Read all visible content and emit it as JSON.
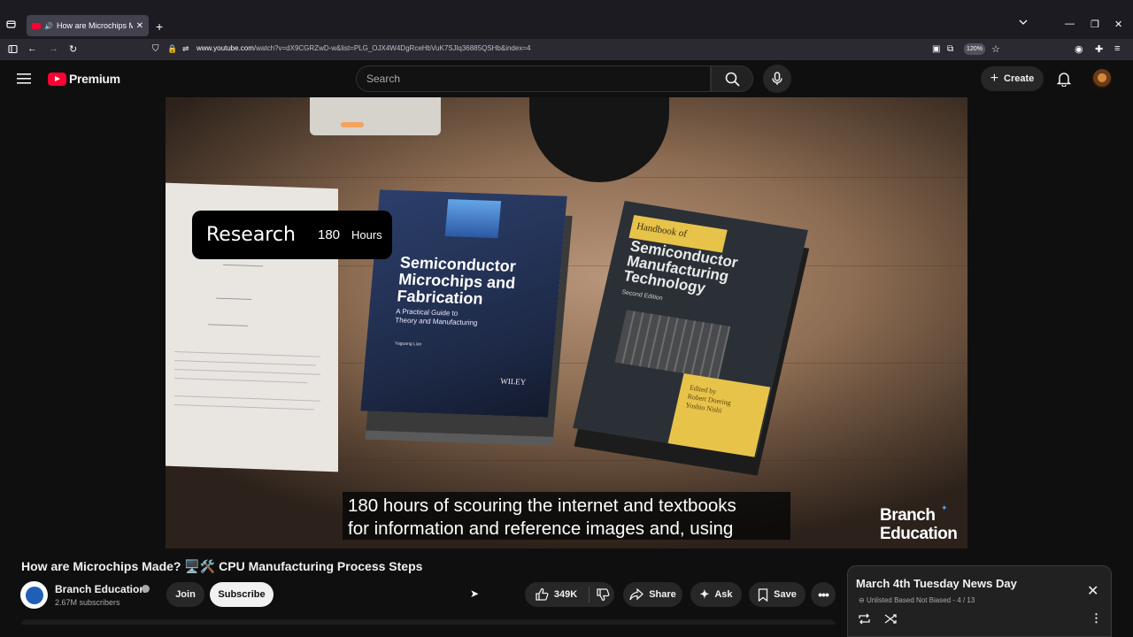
{
  "browser": {
    "tab_title": "How are Microchips Made?",
    "url_prefix": "www.youtube.com",
    "url_rest": "/watch?v=dX9CGRZwD-w&list=PLG_OJX4W4DgRceHbVuK7SJlq36885QSHb&index=4",
    "zoom": "120%"
  },
  "header": {
    "logo_text": "Premium",
    "search_placeholder": "Search",
    "create_label": "Create"
  },
  "video": {
    "overlay_label": "Research",
    "overlay_value": "180",
    "overlay_unit": "Hours",
    "caption_line1": "180 hours of scouring the internet and textbooks",
    "caption_line2": "for information and reference images and, using",
    "watermark_line1": "Branch",
    "watermark_line2": "Education",
    "book_a_title": "Semiconductor Microchips and Fabrication",
    "book_a_subtitle_1": "A Practical Guide to",
    "book_a_subtitle_2": "Theory and Manufacturing",
    "book_a_author": "Yaguang Lian",
    "book_a_publisher": "WILEY",
    "book_b_band": "Handbook of",
    "book_b_title": "Semiconductor Manufacturing Technology",
    "book_b_edition": "Second Edition",
    "book_b_editors_1": "Edited by",
    "book_b_editors_2": "Robert Doering",
    "book_b_editors_3": "Yoshio Nishi"
  },
  "meta": {
    "title": "How are Microchips Made? 🖥️🛠️ CPU Manufacturing Process Steps",
    "channel_name": "Branch Education",
    "subscribers": "2.67M subscribers",
    "join_label": "Join",
    "subscribe_label": "Subscribe",
    "like_count": "349K",
    "share_label": "Share",
    "ask_label": "Ask",
    "save_label": "Save"
  },
  "playlist": {
    "title": "March 4th Tuesday News Day",
    "visibility": "Unlisted",
    "owner": "Based Not Biased",
    "position": "4 / 13"
  },
  "colors": {
    "brand_red": "#ff0033",
    "background": "#0f0f0f",
    "pill": "#272727"
  }
}
